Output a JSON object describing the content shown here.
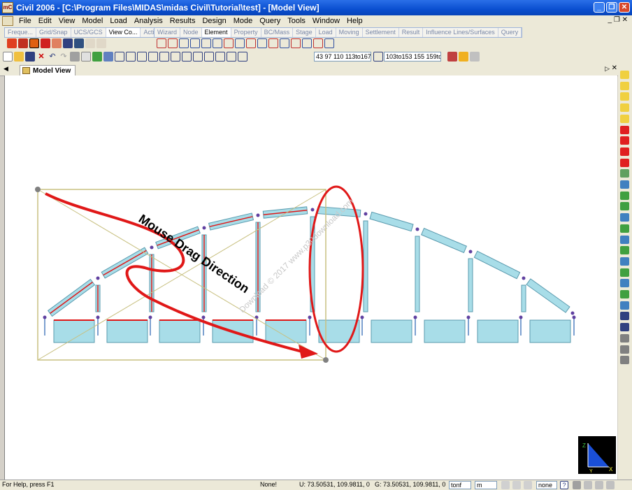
{
  "window": {
    "title": "Civil 2006 - [C:\\Program Files\\MIDAS\\midas Civil\\Tutorial\\test] - [Model View]",
    "app_icon_text": "mC"
  },
  "menu": [
    "File",
    "Edit",
    "View",
    "Model",
    "Load",
    "Analysis",
    "Results",
    "Design",
    "Mode",
    "Query",
    "Tools",
    "Window",
    "Help"
  ],
  "tabs_left": [
    "Freque...",
    "Grid/Snap",
    "UCS/GCS",
    "View Co...",
    "Activation"
  ],
  "tabs_left_active": "View Co...",
  "tabs_right": [
    "Wizard",
    "Node",
    "Element",
    "Property",
    "BC/Mass",
    "Stage",
    "Load",
    "Moving",
    "Settlement",
    "Result",
    "Influence Lines/Surfaces",
    "Query"
  ],
  "tabs_right_active": "Element",
  "selection": {
    "nodes": "43 97 110 113to167",
    "elements": "103to153 155 159to"
  },
  "document_tab": "Model View",
  "annotation": {
    "text": "Mouse Drag Direction"
  },
  "watermark": "Download © 2017 www.p30download.com",
  "status": {
    "help": "For Help, press F1",
    "mode": "None!",
    "ucs": "U: 73.50531, 109.9811, 0",
    "gcs": "G: 73.50531, 109.9811, 0",
    "force_unit": "tonf",
    "length_unit": "m",
    "filter": "none"
  },
  "colors": {
    "title_blue": "#0a4fd0",
    "member_cyan": "#a8dde8",
    "annotation_red": "#e01818",
    "frame_olive": "#c8c080"
  }
}
